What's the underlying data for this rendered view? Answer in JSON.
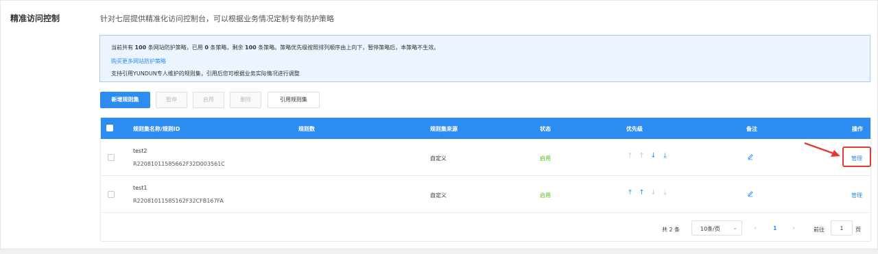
{
  "section": {
    "label": "精准访问控制",
    "description": "针对七层提供精准化访问控制台，可以根据业务情况定制专有防护策略"
  },
  "notice": {
    "line1_prefix": "当前共有 ",
    "total_count": "100",
    "line1_mid1": " 条网站防护策略，已用 ",
    "used_count": "0",
    "line1_mid2": " 条策略，剩余 ",
    "remaining_count": "100",
    "line1_suffix": " 条策略。策略优先级按照排列顺序由上向下，暂停策略后，本策略不生效。",
    "buy_link": "购买更多网站防护策略",
    "line3": "支持引用YUNDUN专人维护的规则集，引用后您可根据业务实际情况进行调整"
  },
  "toolbar": {
    "add": "新增规则集",
    "pause": "暂停",
    "enable": "启用",
    "delete": "删除",
    "import": "引用规则集"
  },
  "table": {
    "headers": {
      "name": "规则集名称/规则ID",
      "count": "规则数",
      "source": "规则集来源",
      "status": "状态",
      "priority": "优先级",
      "note": "备注",
      "action": "操作"
    },
    "rows": [
      {
        "name": "test2",
        "id": "R22081011585662F32D003561C",
        "source": "自定义",
        "status": "启用",
        "action": "管理"
      },
      {
        "name": "test1",
        "id": "R22081011585162F32CFB167FA",
        "source": "自定义",
        "status": "启用",
        "action": "管理"
      }
    ]
  },
  "pagination": {
    "total": "共 2 条",
    "page_size": "10条/页",
    "current_page": "1",
    "goto_label": "前往",
    "goto_value": "1",
    "page_label": "页"
  },
  "colors": {
    "primary": "#2d8cf0",
    "success": "#52c41a",
    "annotation": "#e53935"
  },
  "icons": {
    "priority": [
      "move-top-icon",
      "move-up-icon",
      "move-down-icon",
      "move-bottom-icon"
    ],
    "edit": "pencil-icon"
  }
}
